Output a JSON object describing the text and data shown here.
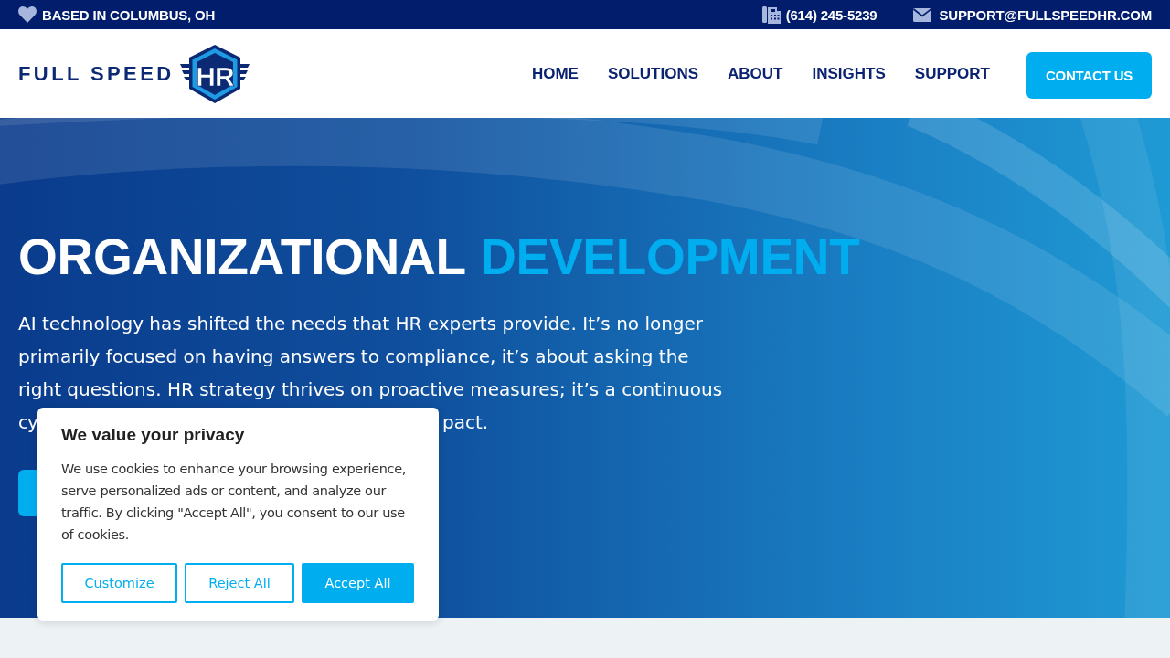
{
  "top_bar": {
    "location": "BASED IN COLUMBUS, OH",
    "phone": "(614) 245-5239",
    "email": "SUPPORT@FULLSPEEDHR.COM"
  },
  "header": {
    "logo": {
      "text": "FULL SPEED",
      "badge": "HR"
    },
    "nav": [
      {
        "label": "HOME"
      },
      {
        "label": "SOLUTIONS"
      },
      {
        "label": "ABOUT"
      },
      {
        "label": "INSIGHTS"
      },
      {
        "label": "SUPPORT"
      }
    ],
    "cta": "CONTACT US"
  },
  "hero": {
    "heading": "ORGANIZATIONAL",
    "heading_highlight": "DEVELOPMENT",
    "description": "AI technology has shifted the needs that HR experts provide. It’s no longer primarily focused on having answers to compliance, it’s about asking the right questions. HR strategy thrives on proactive measures; it’s a continuous",
    "description_fragments": [
      "cy",
      "pact."
    ]
  },
  "cookie_banner": {
    "title": "We value your privacy",
    "text": "We use cookies to enhance your browsing experience, serve personalized ads or content, and analyze our traffic. By clicking \"Accept All\", you consent to our use of cookies.",
    "buttons": [
      {
        "label": "Customize",
        "kind": "outline"
      },
      {
        "label": "Reject All",
        "kind": "outline"
      },
      {
        "label": "Accept All",
        "kind": "filled"
      }
    ]
  }
}
